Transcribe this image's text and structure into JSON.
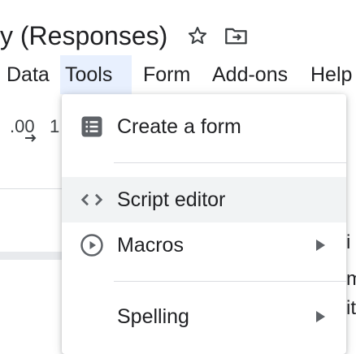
{
  "document": {
    "title": "y (Responses)",
    "star_icon": "star-icon",
    "folder_icon": "move-to-folder-icon"
  },
  "menubar": {
    "items": [
      {
        "label": "Data"
      },
      {
        "label": "Tools"
      },
      {
        "label": "Form"
      },
      {
        "label": "Add-ons"
      },
      {
        "label": "Help"
      }
    ],
    "active": "Tools",
    "active_color": "#e8f0fe"
  },
  "toolbar": {
    "decimal_label": ".00",
    "fragment": "1"
  },
  "tools_menu": {
    "items": [
      {
        "label": "Create a form",
        "icon": "form-icon"
      },
      {
        "label": "Script editor",
        "icon": "code-icon"
      },
      {
        "label": "Macros",
        "icon": "play-circle-icon",
        "submenu": true
      },
      {
        "label": "Spelling",
        "submenu": true
      }
    ],
    "hover_item": "Script editor"
  },
  "sheet_right_fragments": [
    "i",
    "m",
    "it"
  ]
}
